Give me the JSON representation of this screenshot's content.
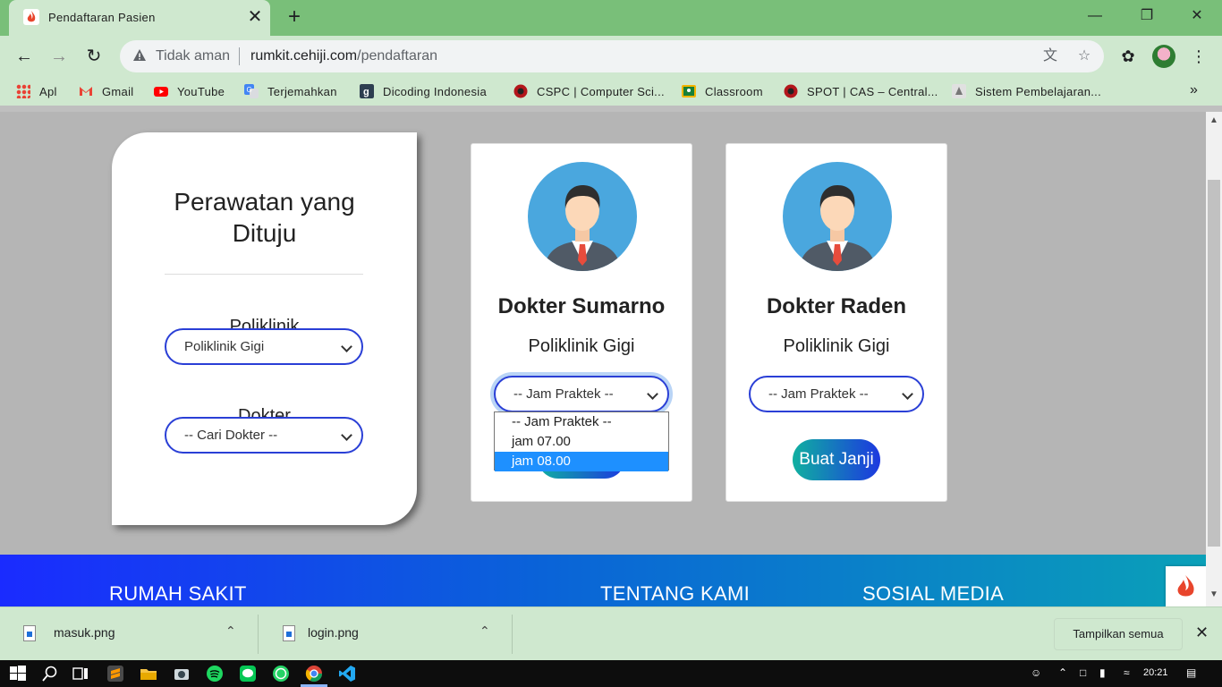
{
  "browser": {
    "tab_title": "Pendaftaran Pasien",
    "tab_close": "✕",
    "new_tab": "+",
    "security_label": "Tidak aman",
    "url_domain": "rumkit.cehiji.com",
    "url_path": "/pendaftaran",
    "bookmarks": [
      {
        "label": "Apl",
        "icon": "apps-grid-icon"
      },
      {
        "label": "Gmail",
        "icon": "gmail-icon"
      },
      {
        "label": "YouTube",
        "icon": "youtube-icon"
      },
      {
        "label": "Terjemahkan",
        "icon": "translate-icon"
      },
      {
        "label": "Dicoding Indonesia",
        "icon": "dicoding-icon"
      },
      {
        "label": "CSPC | Computer Sci...",
        "icon": "cspc-icon"
      },
      {
        "label": "Classroom",
        "icon": "classroom-icon"
      },
      {
        "label": "SPOT | CAS – Central...",
        "icon": "spot-icon"
      },
      {
        "label": "Sistem Pembelajaran...",
        "icon": "sistem-icon"
      }
    ],
    "more_bookmarks": "»"
  },
  "filter": {
    "title_line1": "Perawatan yang",
    "title_line2": "Dituju",
    "poliklinik_label": "Poliklinik",
    "poliklinik_value": "Poliklinik Gigi",
    "dokter_label": "Dokter",
    "dokter_value": "-- Cari Dokter --"
  },
  "doctors": [
    {
      "name": "Dokter Sumarno",
      "poli": "Poliklinik Gigi",
      "jam_value": "-- Jam Praktek --",
      "button": "Buat Janji"
    },
    {
      "name": "Dokter Raden",
      "poli": "Poliklinik Gigi",
      "jam_value": "-- Jam Praktek --",
      "button": "Buat Janji"
    }
  ],
  "jam_dropdown": {
    "options": [
      "-- Jam Praktek --",
      "jam 07.00",
      "jam 08.00"
    ],
    "highlighted": "jam 08.00"
  },
  "footer": {
    "col1": "RUMAH SAKIT",
    "col2": "TENTANG KAMI",
    "col3": "SOSIAL MEDIA"
  },
  "downloads": {
    "items": [
      "masuk.png",
      "login.png"
    ],
    "show_all": "Tampilkan semua",
    "close": "✕"
  },
  "taskbar": {
    "time": "20:21"
  },
  "colors": {
    "chrome_frame": "#79bf79",
    "chrome_toolbar": "#cfe8cf",
    "select_border": "#2a3fd6",
    "dropdown_highlight": "#1e90ff",
    "footer_start": "#1a2bff",
    "footer_end": "#0aa0b8"
  }
}
